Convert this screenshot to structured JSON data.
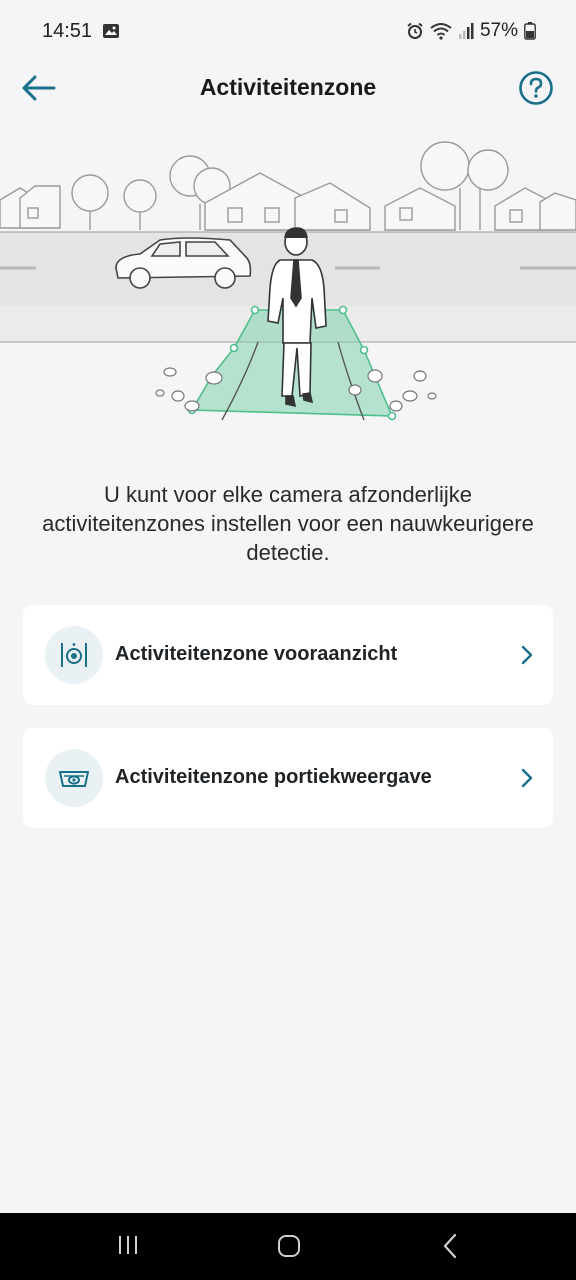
{
  "status_bar": {
    "time": "14:51",
    "battery": "57%",
    "icons": [
      "image-icon",
      "alarm-icon",
      "wifi-icon",
      "signal-icon",
      "battery-icon"
    ]
  },
  "app_bar": {
    "title": "Activiteitenzone",
    "back_icon": "arrow-left-icon",
    "help_icon": "question-circle-icon"
  },
  "illustration": {
    "icon": "street-scene-with-detection-zone",
    "zone_color": "#7fd1ad"
  },
  "description": "U kunt voor elke camera afzonderlijke activiteitenzones instellen voor een nauwkeurigere detectie.",
  "options": [
    {
      "label": "Activiteitenzone vooraanzicht",
      "icon": "front-camera-icon"
    },
    {
      "label": "Activiteitenzone portiekweergave",
      "icon": "porch-camera-icon"
    }
  ],
  "colors": {
    "accent": "#1a6f8a",
    "background": "#f5f5f8",
    "card": "#ffffff",
    "icon_bg": "#eaf1f5",
    "nav_bar": "#000000"
  },
  "nav_bar": {
    "icons": [
      "recent-apps-icon",
      "home-icon",
      "back-icon"
    ]
  }
}
